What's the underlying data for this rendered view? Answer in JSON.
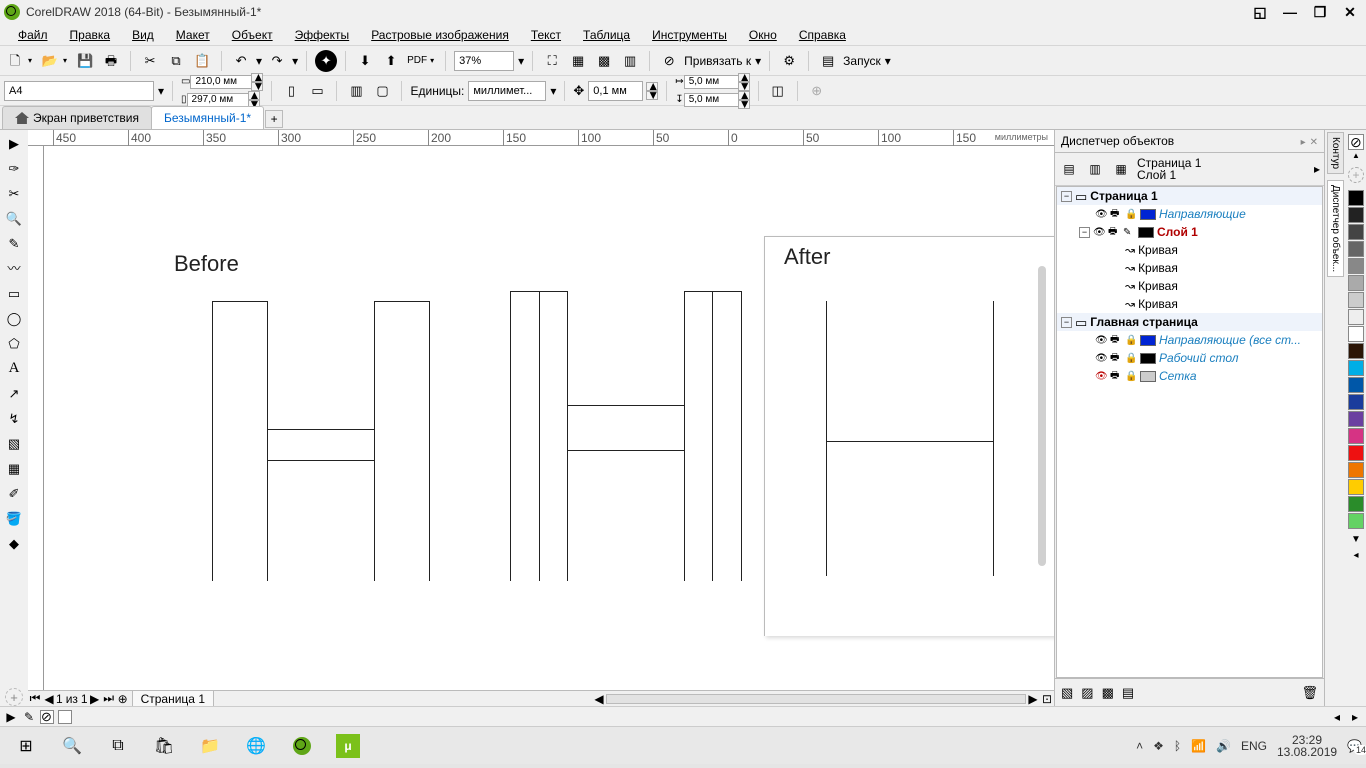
{
  "title": "CorelDRAW 2018 (64-Bit)  -  Безымянный-1*",
  "menu": [
    "Файл",
    "Правка",
    "Вид",
    "Макет",
    "Объект",
    "Эффекты",
    "Растровые изображения",
    "Текст",
    "Таблица",
    "Инструменты",
    "Окно",
    "Справка"
  ],
  "toolbar1": {
    "zoom": "37%",
    "snap_label": "Привязать к",
    "launch_label": "Запуск"
  },
  "toolbar2": {
    "page_size": "A4",
    "width": "210,0 мм",
    "height": "297,0 мм",
    "units_label": "Единицы:",
    "units_value": "миллимет...",
    "nudge": "0,1 мм",
    "dup_x": "5,0 мм",
    "dup_y": "5,0 мм"
  },
  "ws_tabs": {
    "welcome": "Экран приветствия",
    "doc": "Безымянный-1*"
  },
  "ruler": {
    "unit": "миллиметры",
    "ticks": [
      "-450",
      "-400",
      "-350",
      "-300",
      "-250",
      "-200",
      "-150",
      "-100",
      "-50",
      "0",
      "50",
      "100",
      "150"
    ]
  },
  "canvas_labels": {
    "before": "Before",
    "after": "After"
  },
  "page_nav": {
    "cur": "1",
    "sep": "из",
    "total": "1",
    "tab": "Страница 1"
  },
  "dock": {
    "title": "Диспетчер объектов",
    "page_label": "Страница 1",
    "layer_label": "Слой 1",
    "tree": {
      "page1": "Страница 1",
      "guides": "Направляющие",
      "layer1": "Слой 1",
      "curve": "Кривая",
      "master": "Главная страница",
      "guides_all": "Направляющие (все ст...",
      "desktop": "Рабочий стол",
      "grid": "Сетка"
    },
    "tabs": {
      "contour": "Контур",
      "objmgr": "Диспетчер объек..."
    }
  },
  "taskbar": {
    "lang": "ENG",
    "time": "23:29",
    "date": "13.08.2019",
    "notif": "14"
  }
}
